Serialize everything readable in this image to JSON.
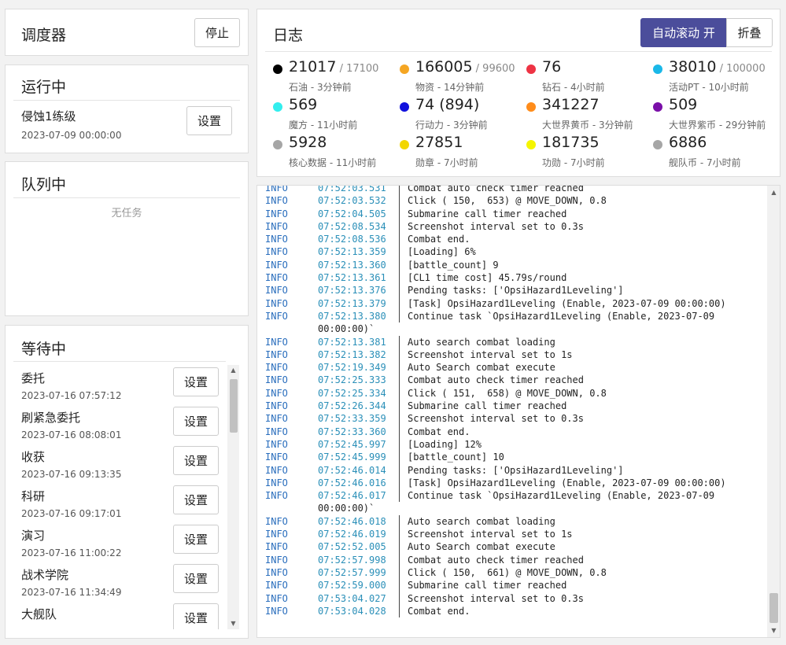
{
  "scheduler": {
    "title": "调度器",
    "stop_label": "停止"
  },
  "running": {
    "title": "运行中",
    "task": {
      "name": "侵蚀1练级",
      "time": "2023-07-09 00:00:00",
      "button": "设置"
    }
  },
  "queue": {
    "title": "队列中",
    "empty": "无任务"
  },
  "waiting": {
    "title": "等待中",
    "tasks": [
      {
        "name": "委托",
        "time": "2023-07-16 07:57:12",
        "button": "设置"
      },
      {
        "name": "刷紧急委托",
        "time": "2023-07-16 08:08:01",
        "button": "设置"
      },
      {
        "name": "收获",
        "time": "2023-07-16 09:13:35",
        "button": "设置"
      },
      {
        "name": "科研",
        "time": "2023-07-16 09:17:01",
        "button": "设置"
      },
      {
        "name": "演习",
        "time": "2023-07-16 11:00:22",
        "button": "设置"
      },
      {
        "name": "战术学院",
        "time": "2023-07-16 11:34:49",
        "button": "设置"
      },
      {
        "name": "大舰队",
        "time": "",
        "button": "设置"
      }
    ]
  },
  "log": {
    "title": "日志",
    "autoscroll_label": "自动滚动 开",
    "collapse_label": "折叠",
    "stats": [
      {
        "value": "21017",
        "max": " / 17100",
        "label": "石油 - 3分钟前",
        "color": "#000000"
      },
      {
        "value": "166005",
        "max": " / 99600",
        "label": "物资 - 14分钟前",
        "color": "#f5a623"
      },
      {
        "value": "76",
        "max": "",
        "label": "钻石 - 4小时前",
        "color": "#ee3344"
      },
      {
        "value": "38010",
        "max": " / 100000",
        "label": "活动PT - 10小时前",
        "color": "#1ab8e8"
      },
      {
        "value": "569",
        "max": "",
        "label": "魔方 - 11小时前",
        "color": "#33eeee"
      },
      {
        "value": "74 (894)",
        "max": "",
        "label": "行动力 - 3分钟前",
        "color": "#1111dd"
      },
      {
        "value": "341227",
        "max": "",
        "label": "大世界黄币 - 3分钟前",
        "color": "#ff8c1a"
      },
      {
        "value": "509",
        "max": "",
        "label": "大世界紫币 - 29分钟前",
        "color": "#7a0fa8"
      },
      {
        "value": "5928",
        "max": "",
        "label": "核心数据 - 11小时前",
        "color": "#a6a6a6"
      },
      {
        "value": "27851",
        "max": "",
        "label": "勋章 - 7小时前",
        "color": "#f2d600"
      },
      {
        "value": "181735",
        "max": "",
        "label": "功勋 - 7小时前",
        "color": "#f5f500"
      },
      {
        "value": "6886",
        "max": "",
        "label": "舰队币 - 7小时前",
        "color": "#a6a6a6"
      }
    ],
    "lines": [
      {
        "level": "INFO",
        "time": "07:52:03.531",
        "msg": "Combat auto check timer reached"
      },
      {
        "level": "INFO",
        "time": "07:52:03.532",
        "msg": "Click ( 150,  653) @ MOVE_DOWN, 0.8"
      },
      {
        "level": "INFO",
        "time": "07:52:04.505",
        "msg": "Submarine call timer reached"
      },
      {
        "level": "INFO",
        "time": "07:52:08.534",
        "msg": "Screenshot interval set to 0.3s"
      },
      {
        "level": "INFO",
        "time": "07:52:08.536",
        "msg": "Combat end."
      },
      {
        "level": "INFO",
        "time": "07:52:13.359",
        "msg": "[Loading] 6%"
      },
      {
        "level": "INFO",
        "time": "07:52:13.360",
        "msg": "[battle_count] 9"
      },
      {
        "level": "INFO",
        "time": "07:52:13.361",
        "msg": "[CL1 time cost] 45.79s/round"
      },
      {
        "level": "INFO",
        "time": "07:52:13.376",
        "msg": "Pending tasks: ['OpsiHazard1Leveling']"
      },
      {
        "level": "INFO",
        "time": "07:52:13.379",
        "msg": "[Task] OpsiHazard1Leveling (Enable, 2023-07-09 00:00:00)"
      },
      {
        "level": "INFO",
        "time": "07:52:13.380",
        "msg": "Continue task `OpsiHazard1Leveling (Enable, 2023-07-09"
      },
      {
        "level": "",
        "time": "00:00:00)`",
        "msg": ""
      },
      {
        "level": "INFO",
        "time": "07:52:13.381",
        "msg": "Auto search combat loading"
      },
      {
        "level": "INFO",
        "time": "07:52:13.382",
        "msg": "Screenshot interval set to 1s"
      },
      {
        "level": "INFO",
        "time": "07:52:19.349",
        "msg": "Auto Search combat execute"
      },
      {
        "level": "INFO",
        "time": "07:52:25.333",
        "msg": "Combat auto check timer reached"
      },
      {
        "level": "INFO",
        "time": "07:52:25.334",
        "msg": "Click ( 151,  658) @ MOVE_DOWN, 0.8"
      },
      {
        "level": "INFO",
        "time": "07:52:26.344",
        "msg": "Submarine call timer reached"
      },
      {
        "level": "INFO",
        "time": "07:52:33.359",
        "msg": "Screenshot interval set to 0.3s"
      },
      {
        "level": "INFO",
        "time": "07:52:33.360",
        "msg": "Combat end."
      },
      {
        "level": "INFO",
        "time": "07:52:45.997",
        "msg": "[Loading] 12%"
      },
      {
        "level": "INFO",
        "time": "07:52:45.999",
        "msg": "[battle_count] 10"
      },
      {
        "level": "INFO",
        "time": "07:52:46.014",
        "msg": "Pending tasks: ['OpsiHazard1Leveling']"
      },
      {
        "level": "INFO",
        "time": "07:52:46.016",
        "msg": "[Task] OpsiHazard1Leveling (Enable, 2023-07-09 00:00:00)"
      },
      {
        "level": "INFO",
        "time": "07:52:46.017",
        "msg": "Continue task `OpsiHazard1Leveling (Enable, 2023-07-09"
      },
      {
        "level": "",
        "time": "00:00:00)`",
        "msg": ""
      },
      {
        "level": "INFO",
        "time": "07:52:46.018",
        "msg": "Auto search combat loading"
      },
      {
        "level": "INFO",
        "time": "07:52:46.019",
        "msg": "Screenshot interval set to 1s"
      },
      {
        "level": "INFO",
        "time": "07:52:52.005",
        "msg": "Auto Search combat execute"
      },
      {
        "level": "INFO",
        "time": "07:52:57.998",
        "msg": "Combat auto check timer reached"
      },
      {
        "level": "INFO",
        "time": "07:52:57.999",
        "msg": "Click ( 150,  661) @ MOVE_DOWN, 0.8"
      },
      {
        "level": "INFO",
        "time": "07:52:59.000",
        "msg": "Submarine call timer reached"
      },
      {
        "level": "INFO",
        "time": "07:53:04.027",
        "msg": "Screenshot interval set to 0.3s"
      },
      {
        "level": "INFO",
        "time": "07:53:04.028",
        "msg": "Combat end."
      }
    ]
  }
}
